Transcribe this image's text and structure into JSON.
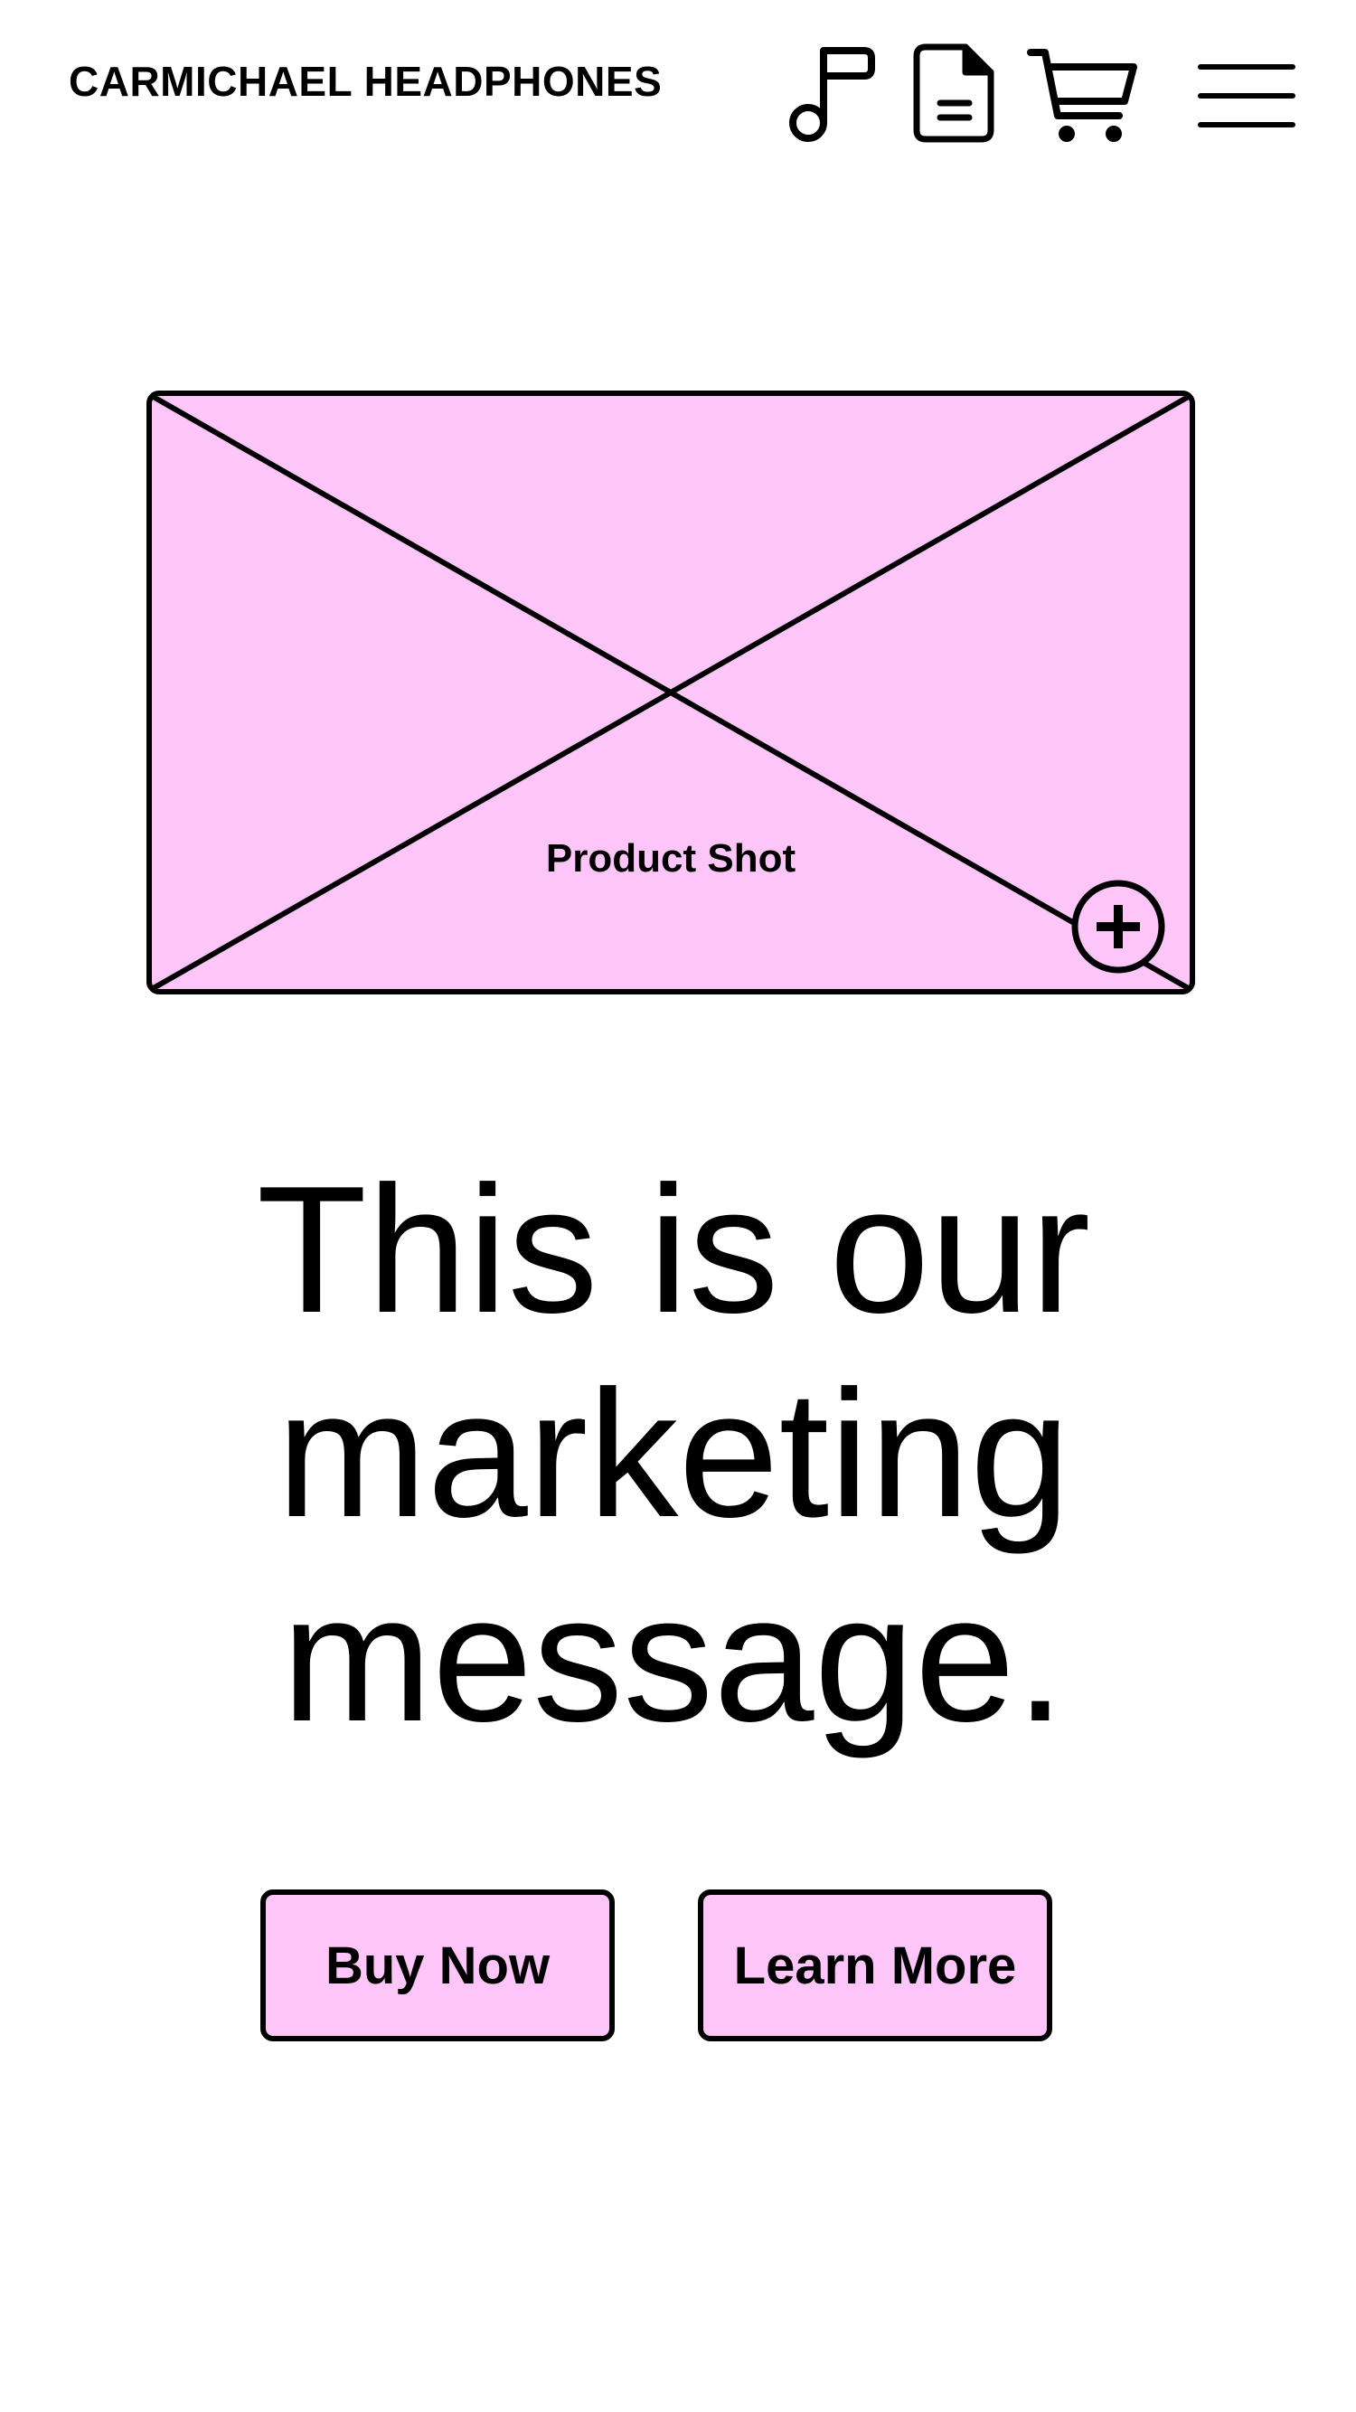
{
  "header": {
    "brand": "CARMICHAEL HEADPHONES",
    "icons": [
      "music-note-icon",
      "document-icon",
      "shopping-cart-icon",
      "hamburger-menu-icon"
    ]
  },
  "hero": {
    "image_label": "Product Shot",
    "zoom_icon": "zoom-in-icon"
  },
  "marketing": {
    "message": "This is our marketing message."
  },
  "actions": {
    "buy_label": "Buy Now",
    "learn_label": "Learn More"
  },
  "colors": {
    "accent_fill": "#fdc5f8",
    "stroke": "#000000",
    "background": "#ffffff"
  }
}
